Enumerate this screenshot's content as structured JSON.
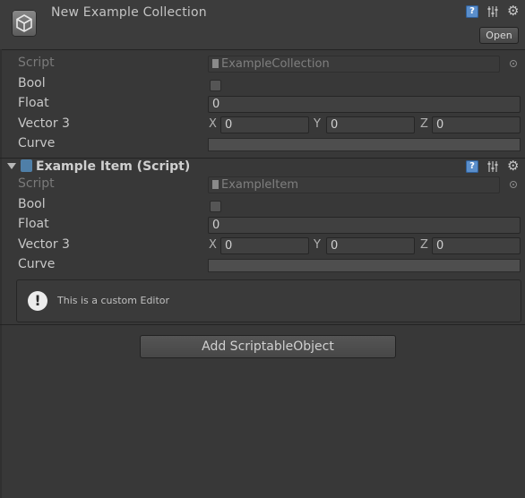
{
  "header": {
    "title": "New Example Collection",
    "open_label": "Open",
    "icons": [
      "help-icon",
      "preset-icon",
      "gear-icon"
    ]
  },
  "asset": {
    "script_label": "Script",
    "script_value": "ExampleCollection",
    "bool_label": "Bool",
    "float_label": "Float",
    "float_value": "0",
    "vector3_label": "Vector 3",
    "x_label": "X",
    "x_value": "0",
    "y_label": "Y",
    "y_value": "0",
    "z_label": "Z",
    "z_value": "0",
    "curve_label": "Curve"
  },
  "component": {
    "title": "Example Item (Script)",
    "script_label": "Script",
    "script_value": "ExampleItem",
    "bool_label": "Bool",
    "float_label": "Float",
    "float_value": "0",
    "vector3_label": "Vector 3",
    "x_label": "X",
    "x_value": "0",
    "y_label": "Y",
    "y_value": "0",
    "z_label": "Z",
    "z_value": "0",
    "curve_label": "Curve"
  },
  "helpbox": {
    "message": "This is a custom Editor",
    "icon": "info-icon"
  },
  "add_button_label": "Add ScriptableObject",
  "colors": {
    "background": "#383838",
    "header": "#3c3c3c",
    "help_icon": "#5a8ecb",
    "field": "#404040"
  }
}
